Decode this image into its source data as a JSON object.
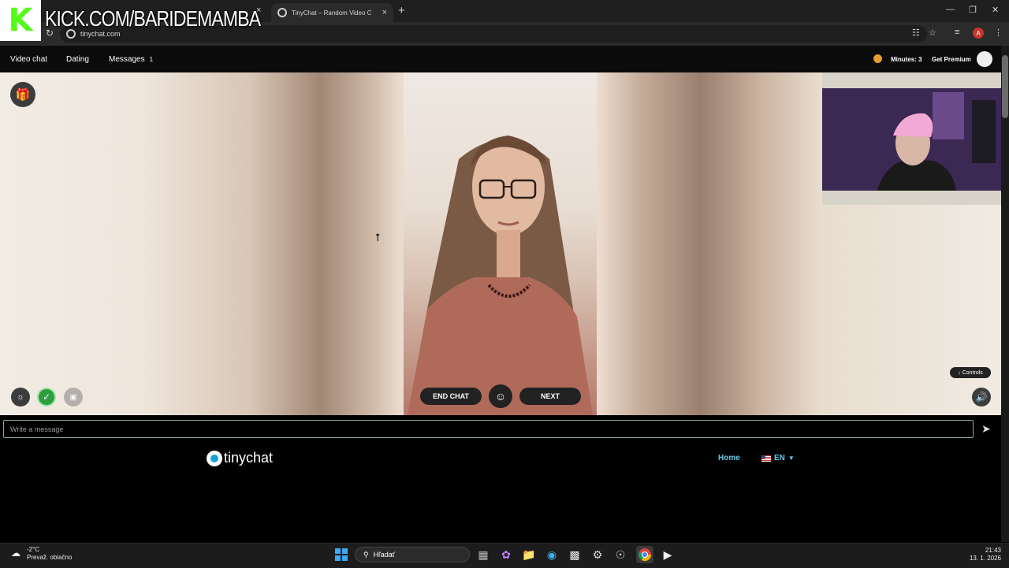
{
  "browser": {
    "active_tab_title": "TinyChat – Random Video C",
    "url": "tinychat.com",
    "new_tab_glyph": "+",
    "close_glyph": "×",
    "profile_initial": "A"
  },
  "overlay": {
    "watermark_text": "KICK.COM/BARIDEMAMBA",
    "logo_letter": "K"
  },
  "nav": {
    "video_chat": "Video chat",
    "dating": "Dating",
    "messages": "Messages",
    "messages_count": "1",
    "minutes": "Minutes: 3",
    "get_premium": "Get Premium"
  },
  "chat": {
    "end_chat": "END CHAT",
    "next": "NEXT",
    "controls": "Controls",
    "message_placeholder": "Write a message"
  },
  "footer": {
    "brand": "tinychat",
    "home": "Home",
    "language": "EN"
  },
  "taskbar": {
    "temperature": "-2°C",
    "weather_desc": "Prevaž. oblačno",
    "search_placeholder": "Hľadať",
    "time": "21:43",
    "date": "13. 1. 2026"
  },
  "colors": {
    "accent_link": "#65c8e9",
    "brand_blue": "#17a2d5",
    "kick_green": "#53fc18",
    "check_green": "#2e9e3f"
  }
}
